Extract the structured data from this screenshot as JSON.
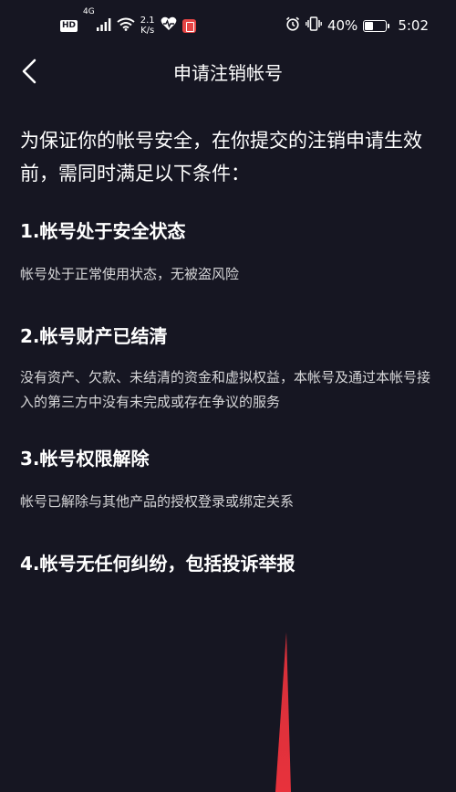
{
  "status_bar": {
    "hd": "HD",
    "network": "4G",
    "speed_value": "2.1",
    "speed_unit": "K/s",
    "battery_percent": "40%",
    "battery_level": 0.4,
    "time": "5:02"
  },
  "nav": {
    "title": "申请注销帐号"
  },
  "intro": "为保证你的帐号安全，在你提交的注销申请生效前，需同时满足以下条件：",
  "conditions": [
    {
      "title": "1.帐号处于安全状态",
      "description": "帐号处于正常使用状态，无被盗风险"
    },
    {
      "title": "2.帐号财产已结清",
      "description": "没有资产、欠款、未结清的资金和虚拟权益，本帐号及通过本帐号接入的第三方中没有未完成或存在争议的服务"
    },
    {
      "title": "3.帐号权限解除",
      "description": "帐号已解除与其他产品的授权登录或绑定关系"
    },
    {
      "title": "4.帐号无任何纠纷，包括投诉举报",
      "description": ""
    }
  ],
  "colors": {
    "background": "#161622",
    "text": "#ffffff",
    "pointer": "#e8323c"
  }
}
